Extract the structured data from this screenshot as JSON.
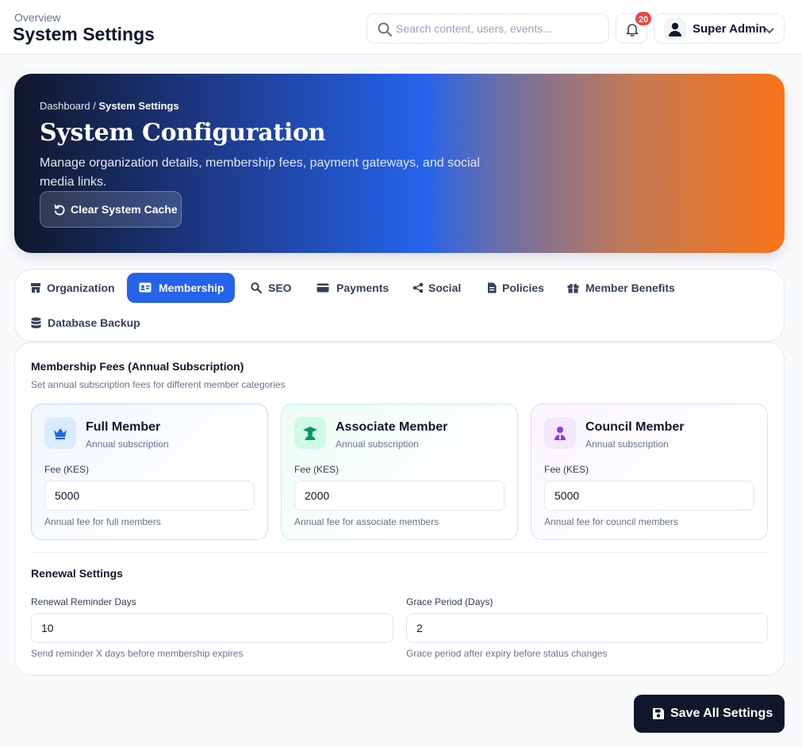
{
  "header": {
    "overline": "Overview",
    "title": "System Settings",
    "search_placeholder": "Search content, users, events...",
    "notifications_count": "20",
    "user_name": "Super Admin"
  },
  "hero": {
    "breadcrumb_root": "Dashboard",
    "breadcrumb_sep": " / ",
    "breadcrumb_current": "System Settings",
    "title": "System Configuration",
    "description": "Manage organization details, membership fees, payment gateways, and social media links.",
    "clear_cache_label": "Clear System Cache"
  },
  "tabs": [
    {
      "label": "Organization",
      "icon": "store-icon",
      "active": false
    },
    {
      "label": "Membership",
      "icon": "id-card-icon",
      "active": true
    },
    {
      "label": "SEO",
      "icon": "search-chart-icon",
      "active": false
    },
    {
      "label": "Payments",
      "icon": "credit-card-icon",
      "active": false
    },
    {
      "label": "Social",
      "icon": "share-icon",
      "active": false
    },
    {
      "label": "Policies",
      "icon": "document-icon",
      "active": false
    },
    {
      "label": "Member Benefits",
      "icon": "gift-icon",
      "active": false
    },
    {
      "label": "Database Backup",
      "icon": "database-icon",
      "active": false
    }
  ],
  "membership": {
    "title": "Membership Fees (Annual Subscription)",
    "subtitle": "Set annual subscription fees for different member categories",
    "fees": [
      {
        "title": "Full Member",
        "subtitle": "Annual subscription",
        "field_label": "Fee (KES)",
        "value": "5000",
        "help": "Annual fee for full members",
        "icon": "crown-icon",
        "accent": "#2563eb"
      },
      {
        "title": "Associate Member",
        "subtitle": "Annual subscription",
        "field_label": "Fee (KES)",
        "value": "2000",
        "help": "Annual fee for associate members",
        "icon": "graduate-icon",
        "accent": "#059669"
      },
      {
        "title": "Council Member",
        "subtitle": "Annual subscription",
        "field_label": "Fee (KES)",
        "value": "5000",
        "help": "Annual fee for council members",
        "icon": "user-tie-icon",
        "accent": "#9333ea"
      }
    ]
  },
  "renewal": {
    "title": "Renewal Settings",
    "reminder_label": "Renewal Reminder Days",
    "reminder_value": "10",
    "reminder_help": "Send reminder X days before membership expires",
    "grace_label": "Grace Period (Days)",
    "grace_value": "2",
    "grace_help": "Grace period after expiry before status changes"
  },
  "footer": {
    "save_label": "Save All Settings"
  },
  "colors": {
    "primary": "#2563eb",
    "dark": "#0f172a",
    "accent_orange": "#f97316",
    "badge": "#ef4444"
  }
}
